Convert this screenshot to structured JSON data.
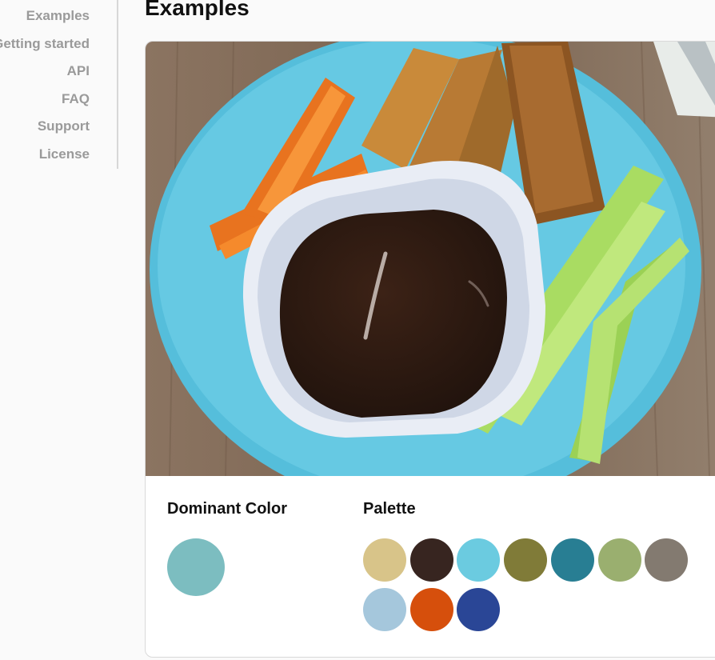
{
  "sidebar": {
    "items": [
      {
        "label": "Examples"
      },
      {
        "label": "Getting started"
      },
      {
        "label": "API"
      },
      {
        "label": "FAQ"
      },
      {
        "label": "Support"
      },
      {
        "label": "License"
      }
    ]
  },
  "main": {
    "title": "Examples",
    "card": {
      "dominant_label": "Dominant Color",
      "dominant_color": "#7cbdc0",
      "palette_label": "Palette",
      "palette": [
        "#d8c489",
        "#372520",
        "#6bcbe0",
        "#807b38",
        "#287e93",
        "#9aaf6f",
        "#837a70",
        "#a5c7dc",
        "#d64f0c",
        "#2a4696"
      ]
    }
  }
}
